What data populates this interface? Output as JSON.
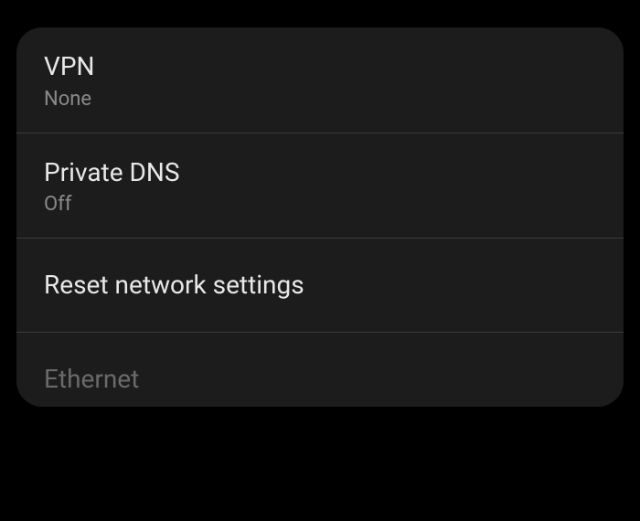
{
  "settings": {
    "items": [
      {
        "title": "VPN",
        "subtitle": "None"
      },
      {
        "title": "Private DNS",
        "subtitle": "Off"
      },
      {
        "title": "Reset network settings"
      },
      {
        "title": "Ethernet"
      }
    ]
  }
}
